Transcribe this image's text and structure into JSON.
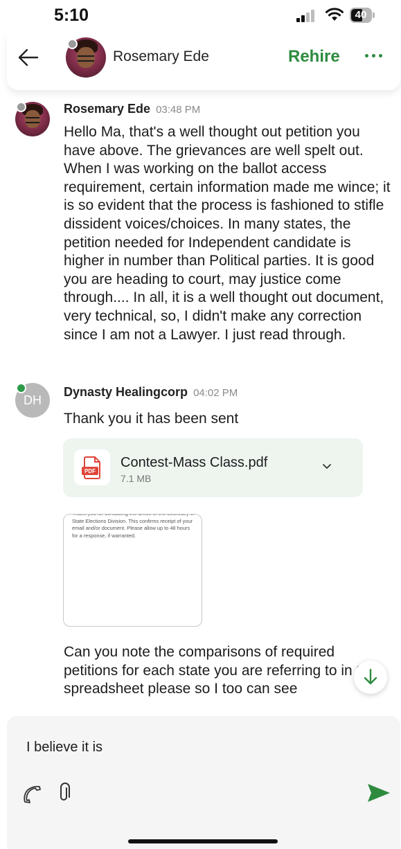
{
  "status_bar": {
    "time": "5:10",
    "battery": "40"
  },
  "header": {
    "contact_name": "Rosemary Ede",
    "rehire_label": "Rehire"
  },
  "messages": [
    {
      "sender": "Rosemary Ede",
      "time": "03:48 PM",
      "text": "Hello Ma, that's a well thought out petition you have above. The grievances are well spelt out. When I was working on the ballot access requirement, certain information made me wince; it is so evident that the process is fashioned to stifle dissident voices/choices. In many states, the petition needed for Independent candidate is higher in number than Political parties. It is good you are heading to court, may justice come through.... In all, it is a well thought out document, very technical, so, I didn't make any correction since I am not a Lawyer. I just read through."
    },
    {
      "sender": "Dynasty Healingcorp",
      "initials": "DH",
      "time": "04:02 PM",
      "text": "Thank you it has been sent",
      "attachment": {
        "name": "Contest-Mass Class.pdf",
        "size": "7.1 MB",
        "type_label": "PDF"
      },
      "image_text": "Thank you for contacting the Office of the Secretary of State Elections Division. This confirms receipt of your email and/or document. Please allow up to 48 hours for a response, if warranted.",
      "followup_text": "Can you note the comparisons of required petitions for each state you are referring to in the spreadsheet please so I too can see"
    }
  ],
  "composer": {
    "value": "I believe it is"
  },
  "colors": {
    "accent": "#2e8b3e",
    "pdf_red": "#e0463b"
  }
}
